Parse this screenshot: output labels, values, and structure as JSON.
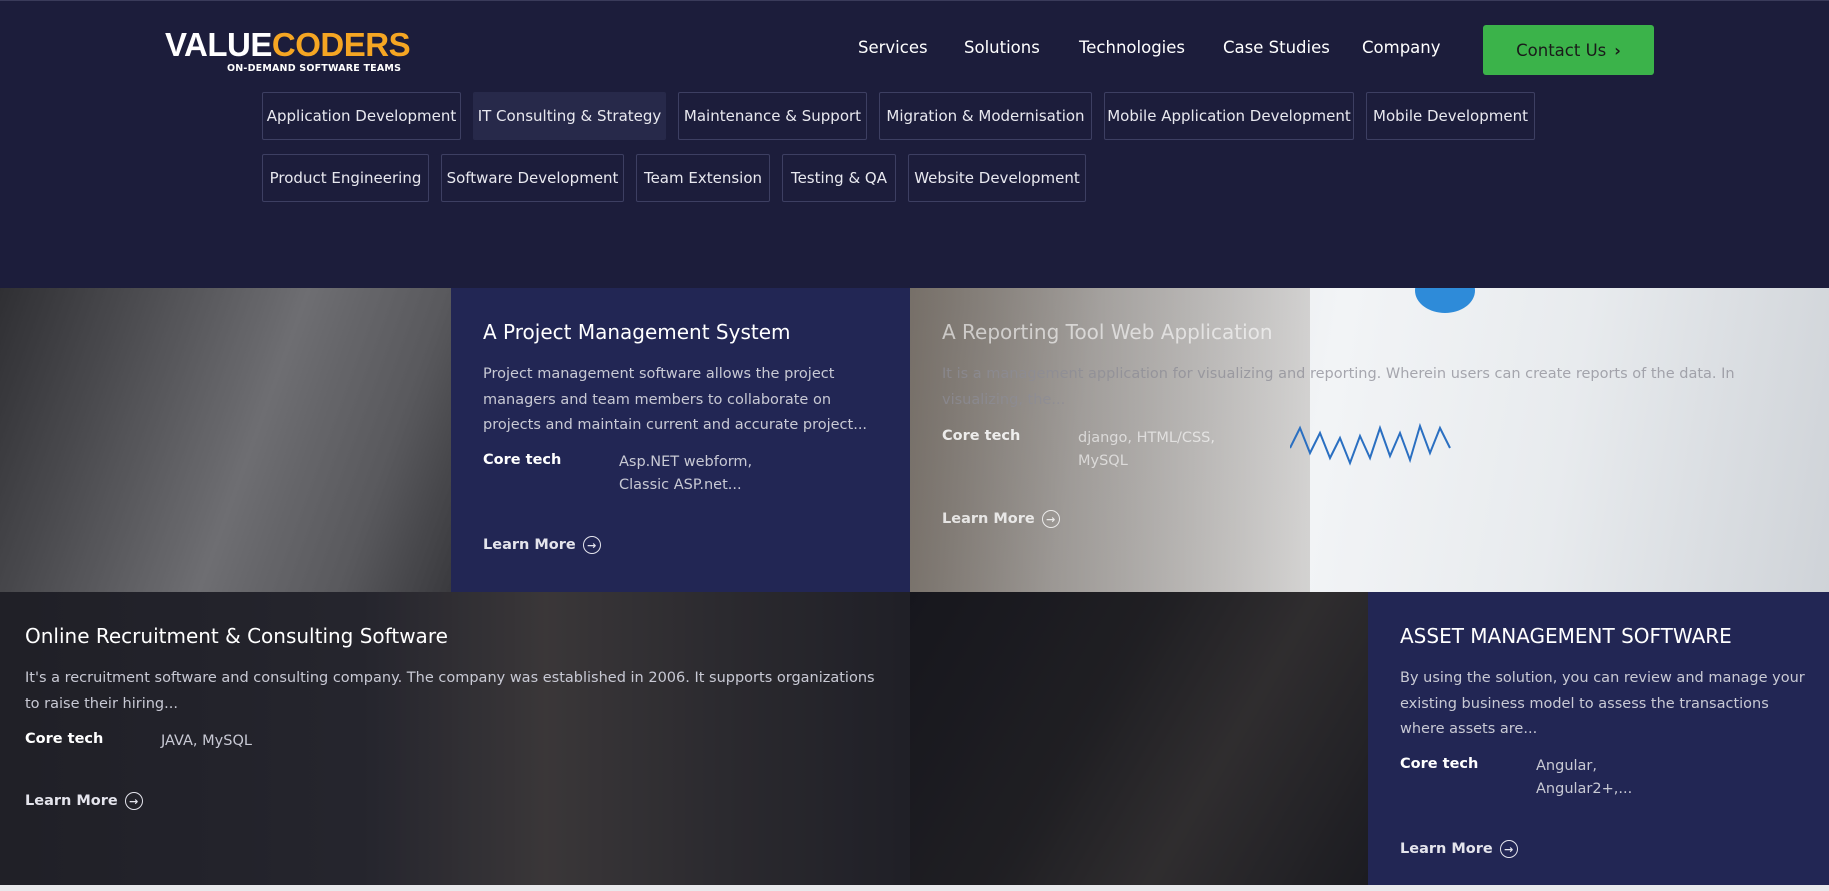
{
  "header": {
    "logo": {
      "part1": "VALUE",
      "part2": "CODERS",
      "tagline": "ON-DEMAND SOFTWARE TEAMS"
    },
    "nav": [
      "Services",
      "Solutions",
      "Technologies",
      "Case Studies",
      "Company"
    ],
    "contact_label": "Contact Us"
  },
  "filters": {
    "row1": [
      "Application Development",
      "IT Consulting & Strategy",
      "Maintenance & Support",
      "Migration & Modernisation",
      "Mobile Application Development",
      "Mobile Development"
    ],
    "row2": [
      "Product Engineering",
      "Software Development",
      "Team Extension",
      "Testing & QA",
      "Website Development"
    ],
    "active": "IT Consulting & Strategy"
  },
  "cases": [
    {
      "title": "A Project Management System",
      "desc": "Project management software allows the project managers and team members to collaborate on projects and maintain current and accurate project...",
      "core_label": "Core tech",
      "core_lines": [
        "Asp.NET webform,",
        "Classic ASP.net..."
      ],
      "learn": "Learn More"
    },
    {
      "title": "A Reporting Tool Web Application",
      "desc": "It is a management application for visualizing and reporting. Wherein users can create reports of the data. In visualizing, the...",
      "core_label": "Core tech",
      "core_lines": [
        "django, HTML/CSS,",
        "MySQL"
      ],
      "learn": "Learn More"
    },
    {
      "title": "Online Recruitment & Consulting Software",
      "desc": "It's a recruitment software and consulting company. The company was established in 2006. It supports organizations to raise their hiring...",
      "core_label": "Core tech",
      "core_lines": [
        "JAVA, MySQL"
      ],
      "learn": "Learn More"
    },
    {
      "title": "ASSET MANAGEMENT SOFTWARE",
      "desc": "By using the solution, you can review and manage your existing business model to assess the transactions where assets are...",
      "core_label": "Core tech",
      "core_lines": [
        "Angular,",
        "Angular2+,..."
      ],
      "learn": "Learn More"
    }
  ],
  "colors": {
    "accent": "#f5a623",
    "contact_bg": "#3bb34a",
    "panel": "#222654",
    "header_bg": "#1c1d3b"
  }
}
